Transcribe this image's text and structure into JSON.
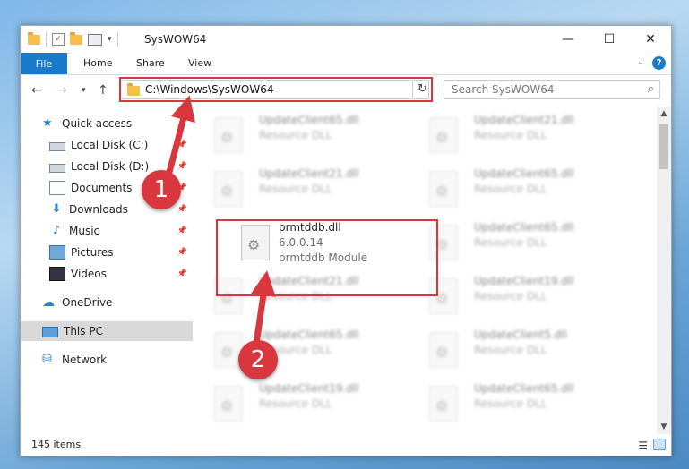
{
  "window": {
    "title": "SysWOW64",
    "controls": {
      "minimize": "—",
      "maximize": "☐",
      "close": "✕"
    }
  },
  "ribbon": {
    "tabs": [
      {
        "label": "File"
      },
      {
        "label": "Home"
      },
      {
        "label": "Share"
      },
      {
        "label": "View"
      }
    ]
  },
  "navigation": {
    "address": "C:\\Windows\\SysWOW64",
    "search_placeholder": "Search SysWOW64"
  },
  "sidebar": {
    "items": [
      {
        "label": "Quick access",
        "icon": "star-icon"
      },
      {
        "label": "Local Disk (C:)",
        "icon": "disk-icon",
        "pinned": true
      },
      {
        "label": "Local Disk (D:)",
        "icon": "disk-icon",
        "pinned": true
      },
      {
        "label": "Documents",
        "icon": "documents-icon",
        "pinned": true
      },
      {
        "label": "Downloads",
        "icon": "download-icon",
        "pinned": true
      },
      {
        "label": "Music",
        "icon": "music-icon",
        "pinned": true
      },
      {
        "label": "Pictures",
        "icon": "pictures-icon",
        "pinned": true
      },
      {
        "label": "Videos",
        "icon": "videos-icon",
        "pinned": true
      },
      {
        "label": "OneDrive",
        "icon": "cloud-icon"
      },
      {
        "label": "This PC",
        "icon": "computer-icon",
        "selected": true
      },
      {
        "label": "Network",
        "icon": "network-icon"
      }
    ]
  },
  "files": [
    {
      "name": "UpdateClient65.dll",
      "line2": "Resource DLL",
      "blurred": true
    },
    {
      "name": "UpdateClient21.dll",
      "line2": "Resource DLL",
      "blurred": true
    },
    {
      "name": "UpdateClient21.dll",
      "line2": "Resource DLL",
      "blurred": true
    },
    {
      "name": "UpdateClient65.dll",
      "line2": "Resource DLL",
      "blurred": true
    },
    {
      "name": "prmtddb.dll",
      "line2": "6.0.0.14",
      "line3": "prmtddb Module",
      "blurred": false
    },
    {
      "name": "UpdateClient65.dll",
      "line2": "Resource DLL",
      "blurred": true
    },
    {
      "name": "UpdateClient21.dll",
      "line2": "Resource DLL",
      "blurred": true
    },
    {
      "name": "UpdateClient19.dll",
      "line2": "Resource DLL",
      "blurred": true
    },
    {
      "name": "UpdateClient65.dll",
      "line2": "Resource DLL",
      "blurred": true
    },
    {
      "name": "UpdateClient5.dll",
      "line2": "Resource DLL",
      "blurred": true
    },
    {
      "name": "UpdateClient19.dll",
      "line2": "Resource DLL",
      "blurred": true
    },
    {
      "name": "UpdateClient65.dll",
      "line2": "Resource DLL",
      "blurred": true
    }
  ],
  "status": {
    "item_count": "145 items"
  },
  "annotations": [
    {
      "label": "1"
    },
    {
      "label": "2"
    }
  ],
  "colors": {
    "accent": "#1979ca",
    "annotation": "#d9363e",
    "selected": "#d9d9d9"
  }
}
